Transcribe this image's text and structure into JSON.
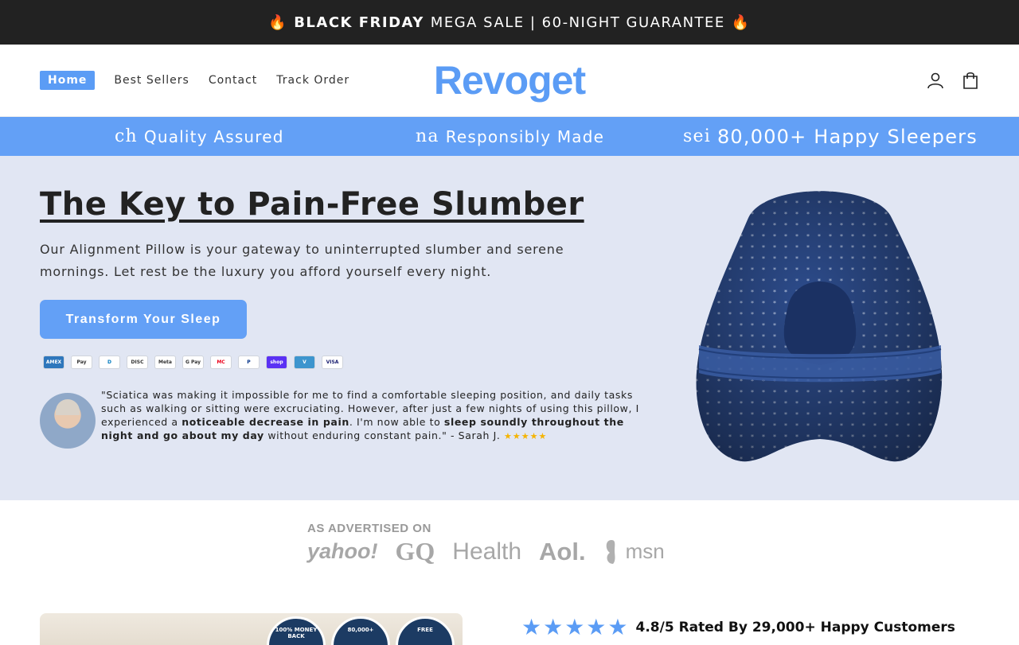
{
  "announcement": {
    "flame": "🔥",
    "bold": "BLACK FRIDAY",
    "rest": "MEGA SALE | 60-NIGHT GUARANTEE"
  },
  "header": {
    "logo": "Revoget",
    "nav": [
      "Home",
      "Best Sellers",
      "Contact",
      "Track Order"
    ],
    "active_nav": "Home",
    "icons": [
      "account-icon",
      "cart-icon"
    ]
  },
  "strip": {
    "items": [
      {
        "glyph": "ch",
        "label": "Quality Assured"
      },
      {
        "glyph": "na",
        "label": "Responsibly Made"
      },
      {
        "glyph": "sei",
        "label": "80,000+ Happy Sleepers"
      }
    ]
  },
  "hero": {
    "title": "The Key to Pain-Free Slumber",
    "description": "Our Alignment Pillow is your gateway to uninterrupted slumber and serene mornings. Let rest be the luxury you afford yourself every night.",
    "cta": "Transform Your Sleep",
    "payments": [
      "AMEX",
      "Pay",
      "D",
      "DISC",
      "Meta",
      "G Pay",
      "MC",
      "P",
      "shop",
      "V",
      "VISA"
    ],
    "testimonial": {
      "part1": "\"Sciatica was making it impossible for me to find a comfortable sleeping position, and daily tasks such as walking or sitting were excruciating. However, after just a few nights of using this pillow, I experienced a ",
      "bold1": "noticeable decrease in pain",
      "part2": ". I'm now able to ",
      "bold2": "sleep soundly throughout the night and go about my day",
      "part3": " without enduring constant pain.\" - Sarah J.",
      "stars": "★★★★★"
    }
  },
  "advertised": {
    "title": "AS ADVERTISED ON",
    "logos": [
      "yahoo!",
      "GQ",
      "Health",
      "Aol.",
      "msn"
    ]
  },
  "rating": {
    "stars": "★★★★★",
    "text": "4.8/5 Rated By 29,000+ Happy Customers",
    "value": 4.8
  },
  "badges": [
    "100% MONEY BACK",
    "80,000+",
    "FREE"
  ],
  "colors": {
    "accent": "#63a0f6",
    "announcement_bg": "#222222",
    "hero_bg": "#e1e6f3",
    "pillow": "#2b4a8a"
  }
}
